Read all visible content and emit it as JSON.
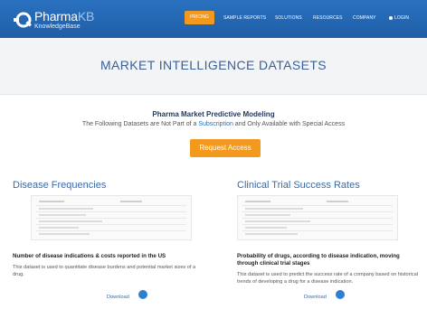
{
  "brand": {
    "name_part1": "Pharma",
    "name_part2": "KB",
    "tagline": "KnowledgeBase"
  },
  "nav": {
    "items": [
      {
        "label": "PRICING"
      },
      {
        "label": "SAMPLE REPORTS"
      },
      {
        "label": "SOLUTIONS"
      },
      {
        "label": "RESOURCES"
      },
      {
        "label": "COMPANY"
      },
      {
        "label": "LOGIN"
      }
    ],
    "active_color": "#f39a1e",
    "login_icon": "user-icon"
  },
  "page": {
    "title": "MARKET INTELLIGENCE DATASETS",
    "subtitle": "Pharma Market Predictive Modeling",
    "desc_before": "The Following Datasets are Not Part of a ",
    "desc_link": "Subscription",
    "desc_after": " and Only Available with Special Access",
    "request_button": "Request Access"
  },
  "datasets": [
    {
      "title": "Disease Frequencies",
      "caption": "Number of disease indications & costs reported in the US",
      "desc": "This dataset is used to quantitate disease burdens and potential market sizes of a drug.",
      "download": "Download"
    },
    {
      "title": "Clinical Trial Success Rates",
      "caption": "Probability of drugs, according to disease indication, moving through clinical trial stages",
      "desc": "This dataset is used to predict the success rate of a company based on historical trends of developing a drug for a disease indication.",
      "download": "Download"
    }
  ],
  "colors": {
    "nav_bg": "#1f5ea6",
    "accent": "#f39a1e",
    "title": "#3b5f95",
    "link": "#2e6fb7"
  }
}
